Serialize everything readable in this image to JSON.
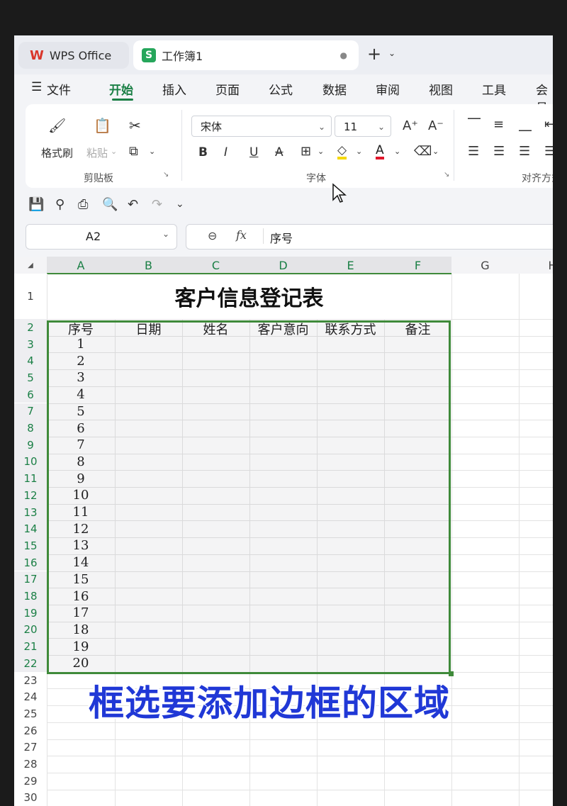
{
  "tabs": {
    "wps": "WPS Office",
    "workbook": "工作簿1"
  },
  "menu": {
    "file": "文件",
    "items": [
      "开始",
      "插入",
      "页面",
      "公式",
      "数据",
      "审阅",
      "视图",
      "工具",
      "会员"
    ]
  },
  "ribbon": {
    "format_painter": "格式刷",
    "paste": "粘贴",
    "clipboard_group": "剪贴板",
    "font_name": "宋体",
    "font_size": "11",
    "font_group": "字体",
    "align_group": "对齐方式"
  },
  "namebox": {
    "value": "A2"
  },
  "formula": {
    "fx": "fx",
    "content": "序号"
  },
  "columns": [
    "A",
    "B",
    "C",
    "D",
    "E",
    "F",
    "G",
    "H"
  ],
  "rows": [
    "1",
    "2",
    "3",
    "4",
    "5",
    "6",
    "7",
    "8",
    "9",
    "10",
    "11",
    "12",
    "13",
    "14",
    "15",
    "16",
    "17",
    "18",
    "19",
    "20",
    "21",
    "22",
    "23",
    "24",
    "25",
    "26",
    "27",
    "28",
    "29",
    "30"
  ],
  "sheet": {
    "title": "客户信息登记表",
    "headers": [
      "序号",
      "日期",
      "姓名",
      "客户意向",
      "联系方式",
      "备注"
    ],
    "serials": [
      "1",
      "2",
      "3",
      "4",
      "5",
      "6",
      "7",
      "8",
      "9",
      "10",
      "11",
      "12",
      "13",
      "14",
      "15",
      "16",
      "17",
      "18",
      "19",
      "20"
    ]
  },
  "caption": "框选要添加边框的区域",
  "colors": {
    "accent": "#1a7f45",
    "caption": "#2038d6",
    "selection_border": "#3f8a3a"
  }
}
